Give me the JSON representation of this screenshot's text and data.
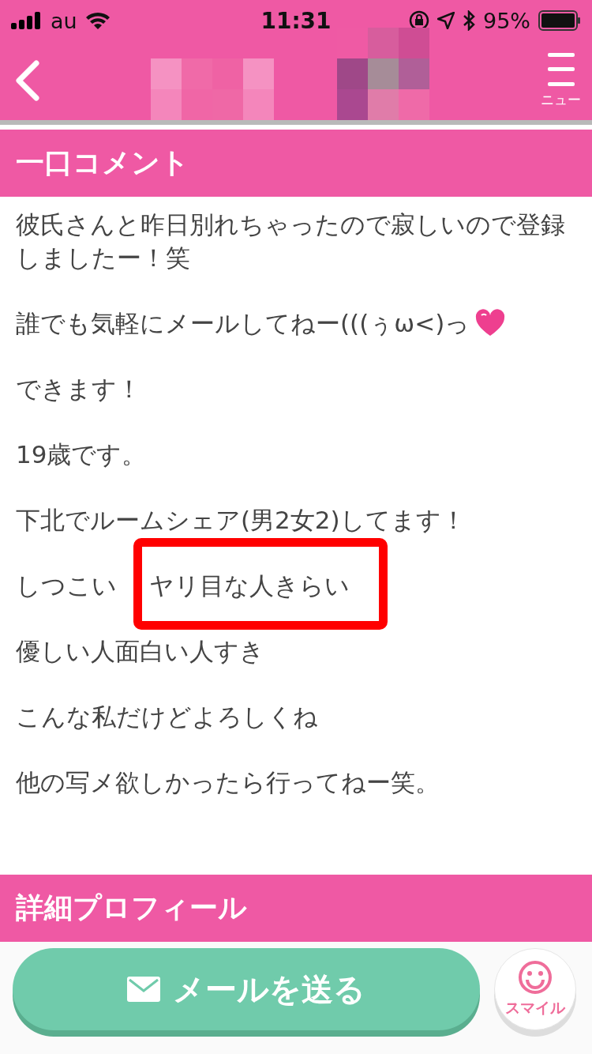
{
  "status_bar": {
    "carrier": "au",
    "time": "11:31",
    "battery": "95%"
  },
  "header": {
    "menu_label": "ニュー"
  },
  "sections": [
    {
      "title": "一口コメント",
      "paragraphs": [
        {
          "text": "彼氏さんと昨日別れちゃったので寂しいので登録しましたー！笑",
          "heart": false
        },
        {
          "text": "誰でも気軽にメールしてねー(((ぅω<)っ",
          "heart": true
        },
        {
          "text": "できます！",
          "heart": false
        },
        {
          "text": "19歳です。",
          "heart": false
        },
        {
          "text": "下北でルームシェア(男2女2)してます！",
          "heart": false
        },
        {
          "text": "しつこい",
          "covered_text": "ヤリ目な人きらい",
          "heart": false
        },
        {
          "text": "優しい人面白い人すき",
          "heart": false
        },
        {
          "text": "こんな私だけどよろしくね",
          "heart": false
        },
        {
          "text": "他の写メ欲しかったら行ってねー笑。",
          "heart": false
        }
      ]
    },
    {
      "title": "詳細プロフィール"
    }
  ],
  "actions": {
    "send_label": "メールを送る",
    "smile_label": "スマイル"
  }
}
